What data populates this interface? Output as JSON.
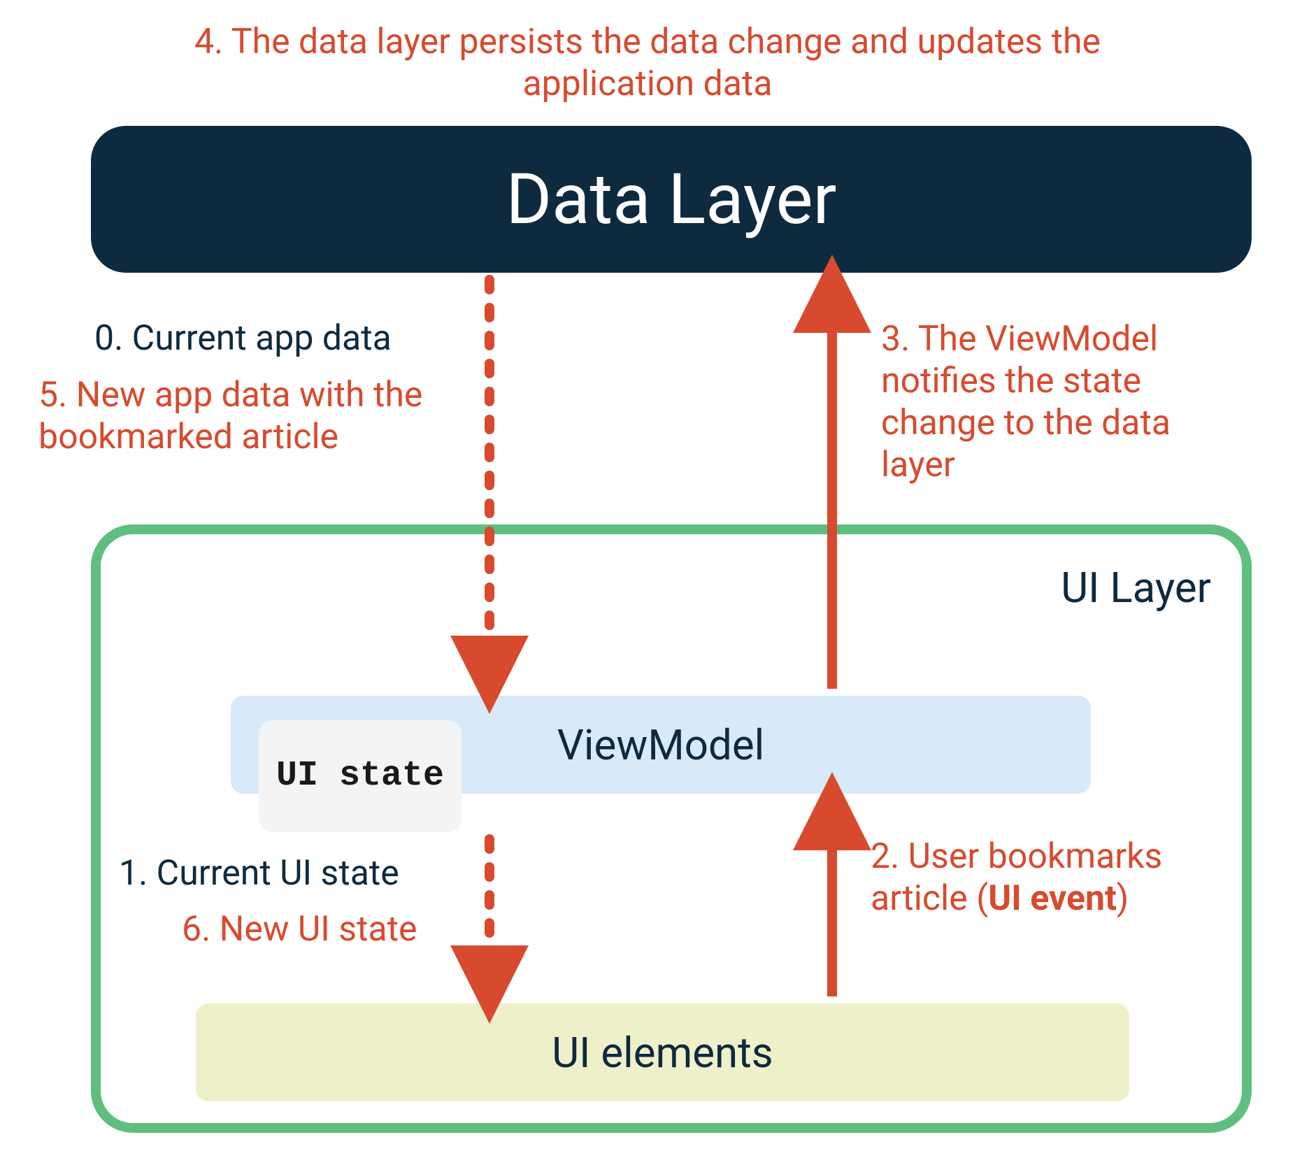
{
  "top_annotation": "4. The data layer persists the data change and updates the application data",
  "data_layer": {
    "label": "Data Layer"
  },
  "ui_layer": {
    "label": "UI Layer"
  },
  "viewmodel": {
    "label": "ViewModel"
  },
  "ui_state": {
    "label": "UI state"
  },
  "ui_elements": {
    "label": "UI elements"
  },
  "annotations": {
    "step0": "0. Current app data",
    "step5": "5. New app data with the bookmarked article",
    "step3": "3. The ViewModel notifies the state change to the data layer",
    "step1": "1. Current UI state",
    "step6": "6. New UI state",
    "step2_prefix": "2. User bookmarks article (",
    "step2_bold": "UI event",
    "step2_suffix": ")"
  },
  "colors": {
    "accent_red": "#d84a2e",
    "dark_navy": "#0e2a3f",
    "ui_layer_border": "#5fbf7f",
    "viewmodel_bg": "#d8e9f8",
    "ui_elements_bg": "#eef0c9",
    "ui_state_bg": "#f4f4f4"
  }
}
